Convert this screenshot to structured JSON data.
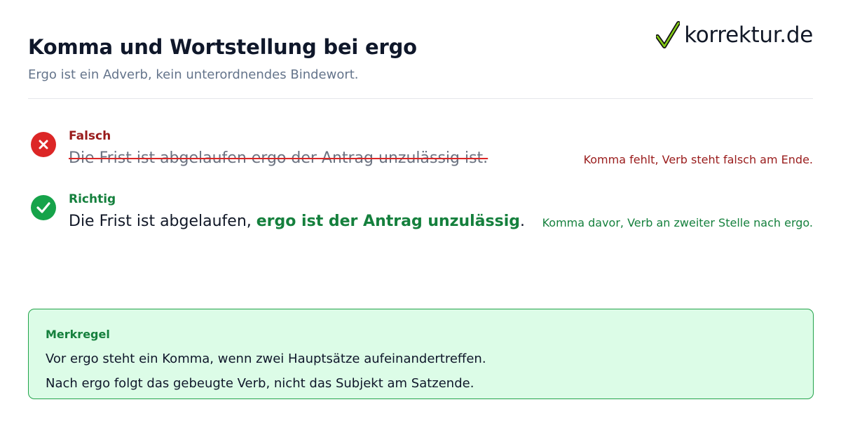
{
  "header": {
    "title": "Komma und Wortstellung bei ergo",
    "subtitle": "Ergo ist ein Adverb, kein unterordnendes Bindewort."
  },
  "brand": {
    "name": "korrektur.de",
    "icon": "checkmark-logo-icon"
  },
  "examples": {
    "wrong": {
      "label": "Falsch",
      "sentence": "Die Frist ist abgelaufen ergo der Antrag unzulässig ist.",
      "note": "Komma fehlt, Verb steht falsch am Ende.",
      "icon": "cross-circle-icon"
    },
    "right": {
      "label": "Richtig",
      "sentence_before": "Die Frist ist abgelaufen, ",
      "sentence_highlight": "ergo ist der Antrag unzulässig",
      "sentence_after": ".",
      "note": "Komma davor, Verb an zweiter Stelle nach ergo.",
      "icon": "check-circle-icon"
    }
  },
  "rule": {
    "title": "Merkregel",
    "lines": [
      "Vor ergo steht ein Komma, wenn zwei Hauptsätze aufeinandertreffen.",
      "Nach ergo folgt das gebeugte Verb, nicht das Subjekt am Satzende."
    ]
  },
  "colors": {
    "wrong": "#dc2626",
    "right": "#16a34a",
    "rule_background": "#dcfce7"
  }
}
